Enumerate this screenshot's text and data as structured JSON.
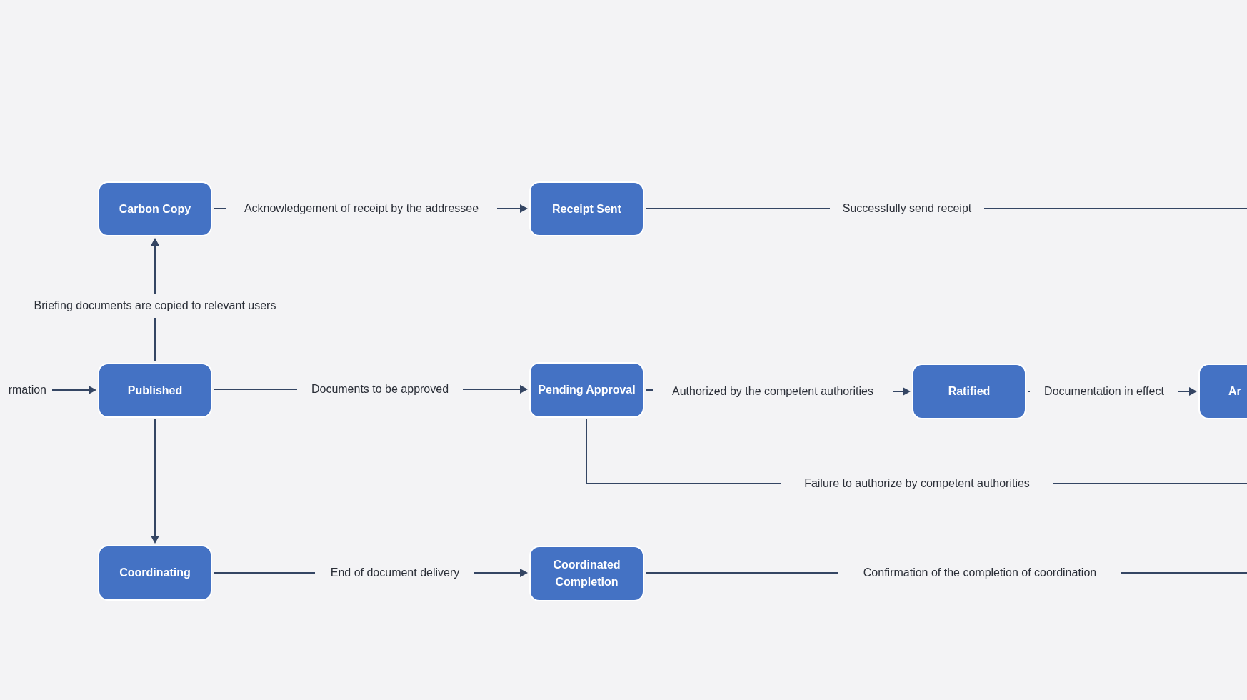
{
  "nodes": [
    {
      "label": "Carbon Copy"
    },
    {
      "label": "Receipt Sent"
    },
    {
      "label": "Published"
    },
    {
      "label": "Pending Approval"
    },
    {
      "label": "Ratified"
    },
    {
      "label": "Ar"
    },
    {
      "label": "Coordinating"
    },
    {
      "label": "Coordinated Completion"
    }
  ],
  "edges": [
    {
      "label": "rmation"
    },
    {
      "label": "Briefing documents are copied to relevant users"
    },
    {
      "label": "Acknowledgement of receipt by the addressee"
    },
    {
      "label": "Successfully send receipt"
    },
    {
      "label": "Documents to be approved"
    },
    {
      "label": "Authorized by the competent authorities"
    },
    {
      "label": "Documentation in effect"
    },
    {
      "label": "Failure to authorize by competent authorities"
    },
    {
      "label": "End of document delivery"
    },
    {
      "label": "Confirmation of the completion of coordination"
    }
  ]
}
